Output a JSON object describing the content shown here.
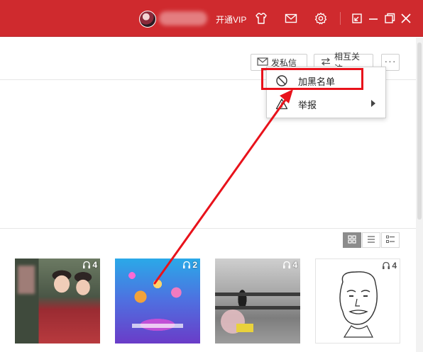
{
  "titlebar": {
    "vip_label": "开通VIP",
    "bg_color": "#cf2a2e"
  },
  "toolbar": {
    "message_label": "发私信",
    "follow_label": "相互关注",
    "more_label": "···"
  },
  "dropdown": {
    "items": [
      {
        "label": "加黑名单",
        "icon": "block-icon"
      },
      {
        "label": "举报",
        "icon": "warning-icon",
        "has_submenu": true
      }
    ]
  },
  "albums": [
    {
      "play_count": "4",
      "icon": "headphones-icon"
    },
    {
      "play_count": "2",
      "icon": "headphones-icon"
    },
    {
      "play_count": "4",
      "icon": "headphones-icon"
    },
    {
      "play_count": "4",
      "icon": "headphones-icon"
    }
  ],
  "annotation_color": "#e8121b"
}
